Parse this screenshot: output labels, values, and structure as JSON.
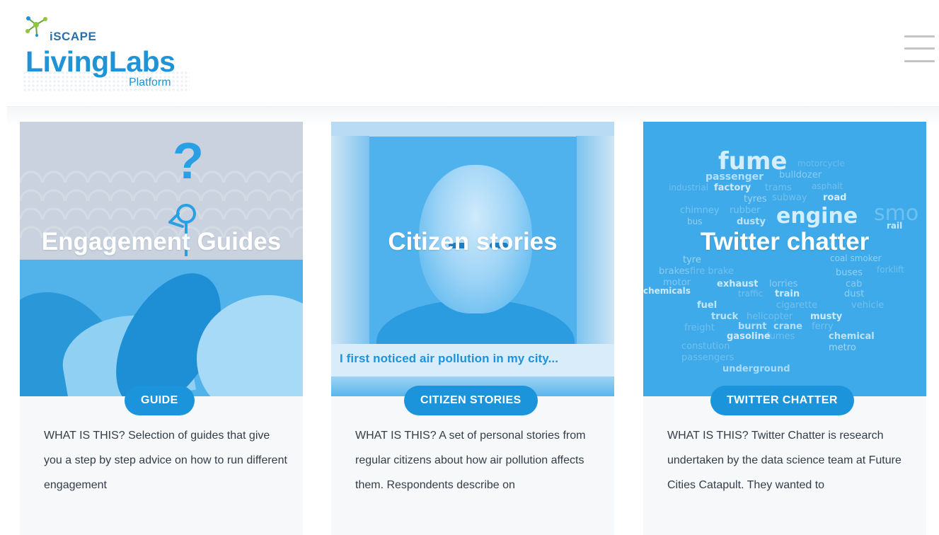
{
  "header": {
    "logo": {
      "brand_small": "iSCAPE",
      "brand_big": "LivingLabs",
      "brand_sub": "Platform"
    },
    "menu_icon": "hamburger-menu-icon"
  },
  "cards": [
    {
      "title": "Engagement Guides",
      "badge": "GUIDE",
      "description": "WHAT IS THIS? Selection of guides that give you a step by step advice on how to run different engagement",
      "image_text": "?"
    },
    {
      "title": "Citizen stories",
      "badge": "CITIZEN STORIES",
      "description": "WHAT IS THIS? A set of personal stories from regular citizens about how air pollution affects them. Respondents describe on",
      "image_caption": "I first noticed air pollution in my city..."
    },
    {
      "title": "Twitter chatter",
      "badge": "TWITTER CHATTER",
      "description": "WHAT IS THIS? Twitter Chatter is research undertaken by the data science team at Future Cities Catapult. They wanted to",
      "word_cloud": [
        "fume",
        "motorcycle",
        "passenger",
        "bulldozer",
        "industrial",
        "factory",
        "trams",
        "asphalt",
        "tyres",
        "subway",
        "road",
        "chimney",
        "rubber",
        "bus",
        "dusty",
        "engine",
        "smo",
        "rail",
        "tyre",
        "coal smoker",
        "forklift",
        "brakes",
        "fire brake",
        "buses",
        "motor",
        "exhaust",
        "lorries",
        "cab",
        "chemicals",
        "traffic",
        "train",
        "dust",
        "fuel",
        "cigarette",
        "vehicle",
        "truck",
        "helicopter",
        "musty",
        "freight",
        "burnt",
        "crane",
        "ferry",
        "gasoline",
        "fumes",
        "chemical",
        "constution",
        "metro",
        "passengers",
        "underground"
      ]
    }
  ],
  "colors": {
    "accent": "#1b94db",
    "card_bg": "#f7f8fa",
    "text": "#333d47",
    "menu_icon": "#c4c4c4"
  }
}
